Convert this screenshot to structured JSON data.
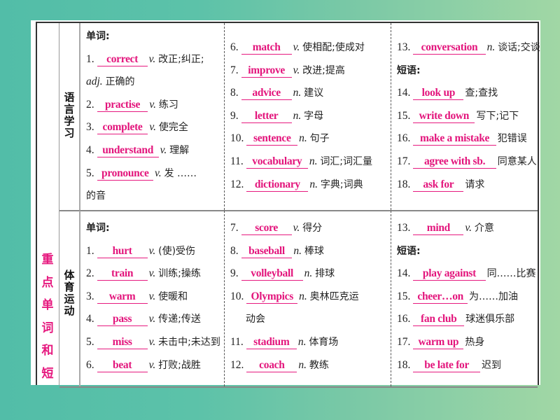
{
  "section_title": "重点单词和短",
  "rows": [
    {
      "category": "语言学习",
      "columns": [
        [
          {
            "type": "label",
            "text": "单词:"
          },
          {
            "num": "1.",
            "word": "correct",
            "pos": "v.",
            "meaning": "改正;纠正;"
          },
          {
            "type": "cont",
            "pos": "adj.",
            "meaning": "正确的"
          },
          {
            "num": "2.",
            "word": "practise",
            "pos": "v.",
            "meaning": "练习"
          },
          {
            "num": "3.",
            "word": "complete",
            "pos": "v.",
            "meaning": "使完全"
          },
          {
            "num": "4.",
            "word": "understand",
            "pos": "v.",
            "meaning": "理解"
          },
          {
            "num": "5.",
            "word": "pronounce",
            "pos": "v.",
            "meaning": "发 ……"
          },
          {
            "type": "cont",
            "meaning": "的音"
          }
        ],
        [
          {
            "num": "6.",
            "word": "match",
            "pos": "v.",
            "meaning": "使相配;使成对"
          },
          {
            "num": "7.",
            "word": "improve",
            "pos": "v.",
            "meaning": "改进;提高"
          },
          {
            "num": "8.",
            "word": "advice",
            "pos": "n.",
            "meaning": "建议"
          },
          {
            "num": "9.",
            "word": "letter",
            "pos": "n.",
            "meaning": "字母"
          },
          {
            "num": "10.",
            "word": "sentence",
            "pos": "n.",
            "meaning": "句子"
          },
          {
            "num": "11.",
            "word": "vocabulary",
            "pos": "n.",
            "meaning": "词汇;词汇量"
          },
          {
            "num": "12.",
            "word": "dictionary",
            "pos": "n.",
            "meaning": "字典;词典"
          }
        ],
        [
          {
            "num": "13.",
            "word": "conversation",
            "pos": "n.",
            "meaning": "谈话;交谈"
          },
          {
            "type": "label",
            "text": "短语:"
          },
          {
            "num": "14.",
            "word": "look up",
            "pos": "",
            "meaning": "查;查找"
          },
          {
            "num": "15.",
            "word": "write down",
            "pos": "",
            "meaning": "写下;记下"
          },
          {
            "num": "16.",
            "word": "make a mistake",
            "pos": "",
            "meaning": "犯错误"
          },
          {
            "num": "17.",
            "word": "agree with sb.",
            "pos": "",
            "meaning": "同意某人"
          },
          {
            "num": "18.",
            "word": "ask for",
            "pos": "",
            "meaning": "请求"
          }
        ]
      ]
    },
    {
      "category": "体育运动",
      "columns": [
        [
          {
            "type": "label",
            "text": "单词:"
          },
          {
            "num": "1.",
            "word": "hurt",
            "pos": "v.",
            "meaning": "(使)受伤"
          },
          {
            "num": "2.",
            "word": "train",
            "pos": "v.",
            "meaning": "训练;操练"
          },
          {
            "num": "3.",
            "word": "warm",
            "pos": "v.",
            "meaning": "使暖和"
          },
          {
            "num": "4.",
            "word": "pass",
            "pos": "v.",
            "meaning": "传递;传送"
          },
          {
            "num": "5.",
            "word": "miss",
            "pos": "v.",
            "meaning": "未击中;未达到"
          },
          {
            "num": "6.",
            "word": "beat",
            "pos": "v.",
            "meaning": "打败;战胜"
          }
        ],
        [
          {
            "num": "7.",
            "word": "score",
            "pos": "v.",
            "meaning": "得分"
          },
          {
            "num": "8.",
            "word": "baseball",
            "pos": "n.",
            "meaning": "棒球"
          },
          {
            "num": "9.",
            "word": "volleyball",
            "pos": "n.",
            "meaning": "排球"
          },
          {
            "num": "10.",
            "word": "Olympics",
            "pos": "n.",
            "meaning": "奥林匹克运"
          },
          {
            "type": "cont",
            "meaning": "动会"
          },
          {
            "num": "11.",
            "word": "stadium",
            "pos": "n.",
            "meaning": "体育场"
          },
          {
            "num": "12.",
            "word": "coach",
            "pos": "n.",
            "meaning": "教练"
          }
        ],
        [
          {
            "num": "13.",
            "word": "mind",
            "pos": "v.",
            "meaning": "介意"
          },
          {
            "type": "label",
            "text": "短语:"
          },
          {
            "num": "14.",
            "word": "play against",
            "pos": "",
            "meaning": "同……比赛"
          },
          {
            "num": "15.",
            "word": "cheer…on",
            "pos": "",
            "meaning": "为……加油"
          },
          {
            "num": "16.",
            "word": "fan club",
            "pos": "",
            "meaning": "球迷俱乐部"
          },
          {
            "num": "17.",
            "word": "warm up",
            "pos": "",
            "meaning": "热身"
          },
          {
            "num": "18.",
            "word": "be late for",
            "pos": "",
            "meaning": "迟到"
          }
        ]
      ]
    }
  ]
}
